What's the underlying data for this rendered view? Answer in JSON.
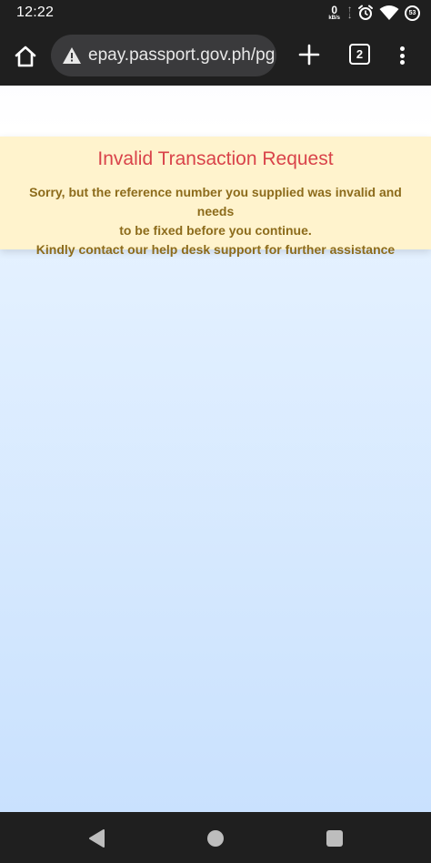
{
  "status_bar": {
    "time": "12:22",
    "net_speed_value": "0",
    "net_speed_unit": "kB/s",
    "battery_level": "53",
    "icons": [
      "alarm-icon",
      "wifi-icon",
      "battery-icon"
    ]
  },
  "browser": {
    "url": "epay.passport.gov.ph/pg",
    "tab_count": "2",
    "icons": [
      "home-icon",
      "warning-icon",
      "plus-icon",
      "menu-icon"
    ]
  },
  "alert": {
    "title": "Invalid Transaction Request",
    "line1": "Sorry, but the reference number you supplied was invalid and needs",
    "line2": "to be fixed before you continue.",
    "line3": "Kindly contact our help desk support for further assistance",
    "title_color": "#d9434a",
    "background_color": "#fff3cd"
  },
  "nav_bar": {
    "icons": [
      "back-icon",
      "home-circle-icon",
      "recents-icon"
    ]
  }
}
